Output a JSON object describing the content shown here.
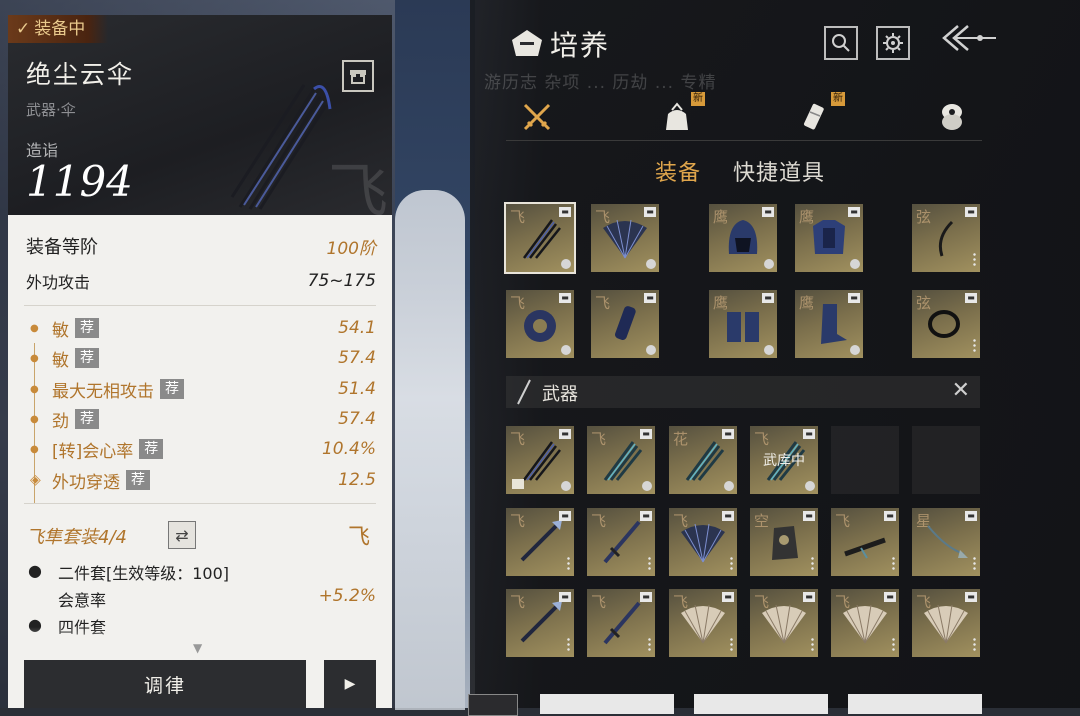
{
  "detail": {
    "equipped_label": "装备中",
    "name": "绝尘云伞",
    "type": "武器·伞",
    "zao_label": "造诣",
    "zao_value": "1194",
    "set_mark": "飞",
    "grade_label": "装备等阶",
    "grade_value": "100阶",
    "attack_label": "外功攻击",
    "attack_value": "75~175",
    "stats": [
      {
        "name": "敏",
        "tag": "荐",
        "value": "54.1"
      },
      {
        "name": "敏",
        "tag": "荐",
        "value": "57.4"
      },
      {
        "name": "最大无相攻击",
        "tag": "荐",
        "value": "51.4"
      },
      {
        "name": "劲",
        "tag": "荐",
        "value": "57.4"
      },
      {
        "name": "[转]会心率",
        "tag": "荐",
        "value": "10.4%"
      },
      {
        "name": "外功穿透",
        "tag": "荐",
        "value": "12.5"
      }
    ],
    "set_title": "飞隼套装4/4",
    "set_icon": "飞",
    "bonus2_title": "二件套[生效等级：100]",
    "bonus2_stat": "会意率",
    "bonus2_value": "+5.2%",
    "bonus4_title": "四件套",
    "tune_button": "调律",
    "next_icon": "play-icon"
  },
  "panel": {
    "title": "培养",
    "subnav": "游历志  杂项  ...  历劫  ...  专精",
    "categories": [
      {
        "name": "equipment",
        "icon": "crossed-swords-icon",
        "new": ""
      },
      {
        "name": "bag",
        "icon": "pouch-icon",
        "new": "新"
      },
      {
        "name": "scroll",
        "icon": "scroll-icon",
        "new": "新"
      },
      {
        "name": "coin",
        "icon": "coin-icon",
        "new": ""
      }
    ],
    "tab_equip": "装备",
    "tab_quick": "快捷道具",
    "equipped_slots": [
      {
        "ch": "飞",
        "art": "umbrella"
      },
      {
        "ch": "飞",
        "art": "fan"
      },
      {
        "ch": "鹰",
        "art": "helmet"
      },
      {
        "ch": "鹰",
        "art": "armor"
      },
      {
        "ch": "弦",
        "art": "ring"
      },
      {
        "ch": "飞",
        "art": "disc"
      },
      {
        "ch": "飞",
        "art": "tube"
      },
      {
        "ch": "鹰",
        "art": "gauntlet"
      },
      {
        "ch": "鹰",
        "art": "boots"
      },
      {
        "ch": "弦",
        "art": "necklace"
      }
    ],
    "weapon_filter": "武器",
    "inventory_slots": [
      {
        "ch": "飞",
        "art": "umbrella",
        "note": ""
      },
      {
        "ch": "飞",
        "art": "umbrella-teal",
        "note": ""
      },
      {
        "ch": "花",
        "art": "umbrella-teal",
        "note": ""
      },
      {
        "ch": "飞",
        "art": "umbrella-teal",
        "note": "武库中"
      },
      {
        "ch": "",
        "art": "",
        "note": ""
      },
      {
        "ch": "",
        "art": "",
        "note": ""
      },
      {
        "ch": "飞",
        "art": "spear",
        "note": ""
      },
      {
        "ch": "飞",
        "art": "sword",
        "note": ""
      },
      {
        "ch": "飞",
        "art": "fan",
        "note": ""
      },
      {
        "ch": "空",
        "art": "gauntlet",
        "note": ""
      },
      {
        "ch": "飞",
        "art": "blade",
        "note": ""
      },
      {
        "ch": "星",
        "art": "rope-dart",
        "note": ""
      },
      {
        "ch": "飞",
        "art": "spear",
        "note": ""
      },
      {
        "ch": "飞",
        "art": "sword",
        "note": ""
      },
      {
        "ch": "飞",
        "art": "fan-light",
        "note": ""
      },
      {
        "ch": "飞",
        "art": "fan-light",
        "note": ""
      },
      {
        "ch": "飞",
        "art": "fan-light",
        "note": ""
      },
      {
        "ch": "飞",
        "art": "fan-light",
        "note": ""
      }
    ]
  },
  "colors": {
    "accent": "#e0a64c",
    "stat": "#b0752c",
    "card_bg": "#f2f1ee"
  }
}
